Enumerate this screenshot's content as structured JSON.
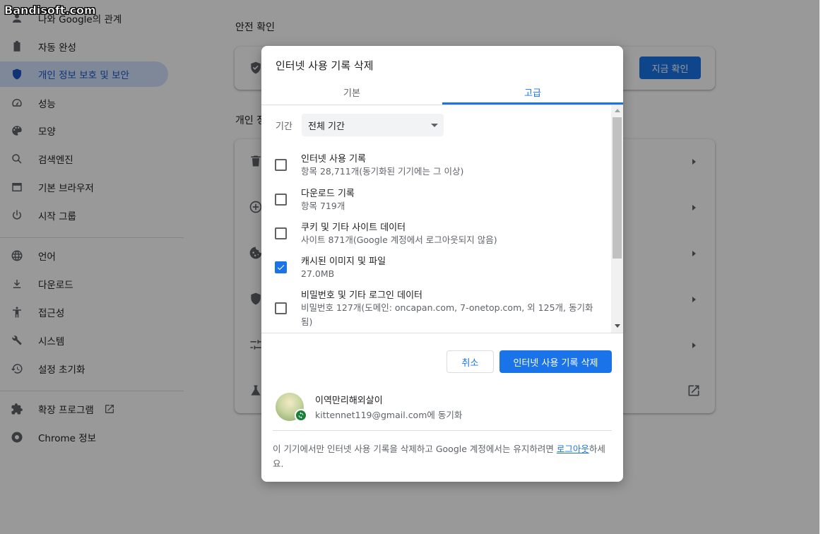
{
  "watermark": "Bandisoft.com",
  "sidebar": {
    "items": [
      {
        "label": "나와 Google의 관계",
        "icon": "person-icon"
      },
      {
        "label": "자동 완성",
        "icon": "clipboard-icon"
      },
      {
        "label": "개인 정보 보호 및 보안",
        "icon": "shield-icon",
        "active": true
      },
      {
        "label": "성능",
        "icon": "speedometer-icon"
      },
      {
        "label": "모양",
        "icon": "palette-icon"
      },
      {
        "label": "검색엔진",
        "icon": "search-icon"
      },
      {
        "label": "기본 브라우저",
        "icon": "browser-icon"
      },
      {
        "label": "시작 그룹",
        "icon": "power-icon"
      },
      {
        "label": "언어",
        "icon": "globe-icon"
      },
      {
        "label": "다운로드",
        "icon": "download-icon"
      },
      {
        "label": "접근성",
        "icon": "accessibility-icon"
      },
      {
        "label": "시스템",
        "icon": "wrench-icon"
      },
      {
        "label": "설정 초기화",
        "icon": "reset-icon"
      },
      {
        "label": "확장 프로그램",
        "icon": "puzzle-icon"
      },
      {
        "label": "Chrome 정보",
        "icon": "chrome-icon"
      }
    ]
  },
  "main": {
    "safety_title": "안전 확인",
    "safety_button": "지금 확인",
    "privacy_title": "개인 정"
  },
  "dialog": {
    "title": "인터넷 사용 기록 삭제",
    "tabs": {
      "basic": "기본",
      "advanced": "고급"
    },
    "period_label": "기간",
    "period_value": "전체 기간",
    "items": [
      {
        "title": "인터넷 사용 기록",
        "sub": "항목 28,711개(동기화된 기기에는 그 이상)",
        "checked": false
      },
      {
        "title": "다운로드 기록",
        "sub": "항목 719개",
        "checked": false
      },
      {
        "title": "쿠키 및 기타 사이트 데이터",
        "sub": "사이트 871개(Google 계정에서 로그아웃되지 않음)",
        "checked": false
      },
      {
        "title": "캐시된 이미지 및 파일",
        "sub": "27.0MB",
        "checked": true
      },
      {
        "title": "비밀번호 및 기타 로그인 데이터",
        "sub": "비밀번호 127개(도메인: oncapan.com, 7-onetop.com, 외 125개, 동기화됨)",
        "checked": false
      }
    ],
    "cancel_label": "취소",
    "delete_label": "인터넷 사용 기록 삭제",
    "account": {
      "name": "이역만리해외살이",
      "email": "kittennet119@gmail.com에 동기화"
    },
    "footer": {
      "text_before": "이 기기에서만 인터넷 사용 기록을 삭제하고 Google 계정에서는 유지하려면 ",
      "link": "로그아웃",
      "text_after": "하세요."
    }
  }
}
